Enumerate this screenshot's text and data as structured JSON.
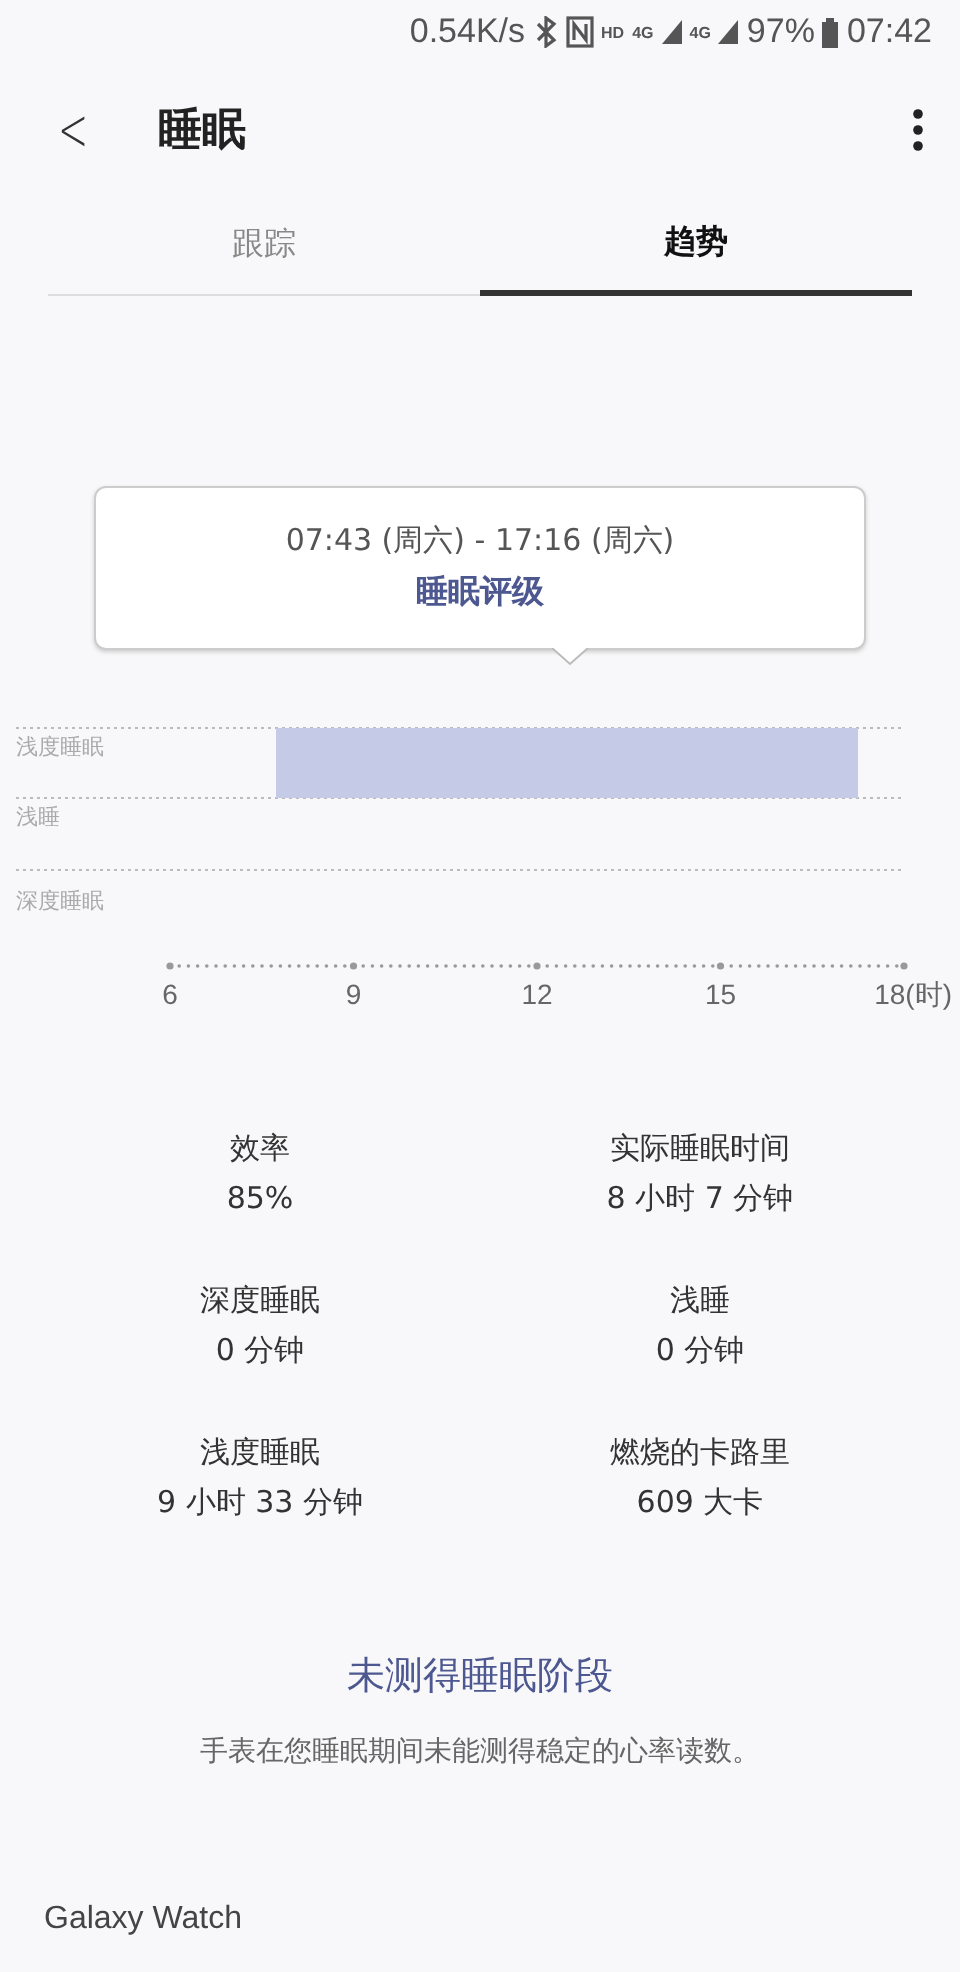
{
  "status_bar": {
    "speed": "0.54K/s",
    "hd": "HD",
    "network_1": "4G",
    "network_2": "4G",
    "battery": "97%",
    "time": "07:42"
  },
  "header": {
    "back": "<",
    "title": "睡眠"
  },
  "tabs": [
    {
      "label": "跟踪",
      "selected": false
    },
    {
      "label": "趋势",
      "selected": true
    }
  ],
  "tooltip": {
    "time_range": "07:43 (周六) - 17:16 (周六)",
    "title": "睡眠评级"
  },
  "sleep_chart": {
    "stage_labels": [
      "浅度睡眠",
      "浅睡",
      "深度睡眠"
    ],
    "x_labels": [
      "6",
      "9",
      "12",
      "15",
      "18(时)"
    ]
  },
  "stats": [
    {
      "label": "效率",
      "value": "85%"
    },
    {
      "label": "实际睡眠时间",
      "value": "8 小时 7 分钟"
    },
    {
      "label": "深度睡眠",
      "value": "0 分钟"
    },
    {
      "label": "浅睡",
      "value": "0 分钟"
    },
    {
      "label": "浅度睡眠",
      "value": "9 小时 33 分钟"
    },
    {
      "label": "燃烧的卡路里",
      "value": "609 大卡"
    }
  ],
  "notice": {
    "title": "未测得睡眠阶段",
    "text": "手表在您睡眠期间未能测得稳定的心率读数。"
  },
  "device": "Galaxy Watch"
}
